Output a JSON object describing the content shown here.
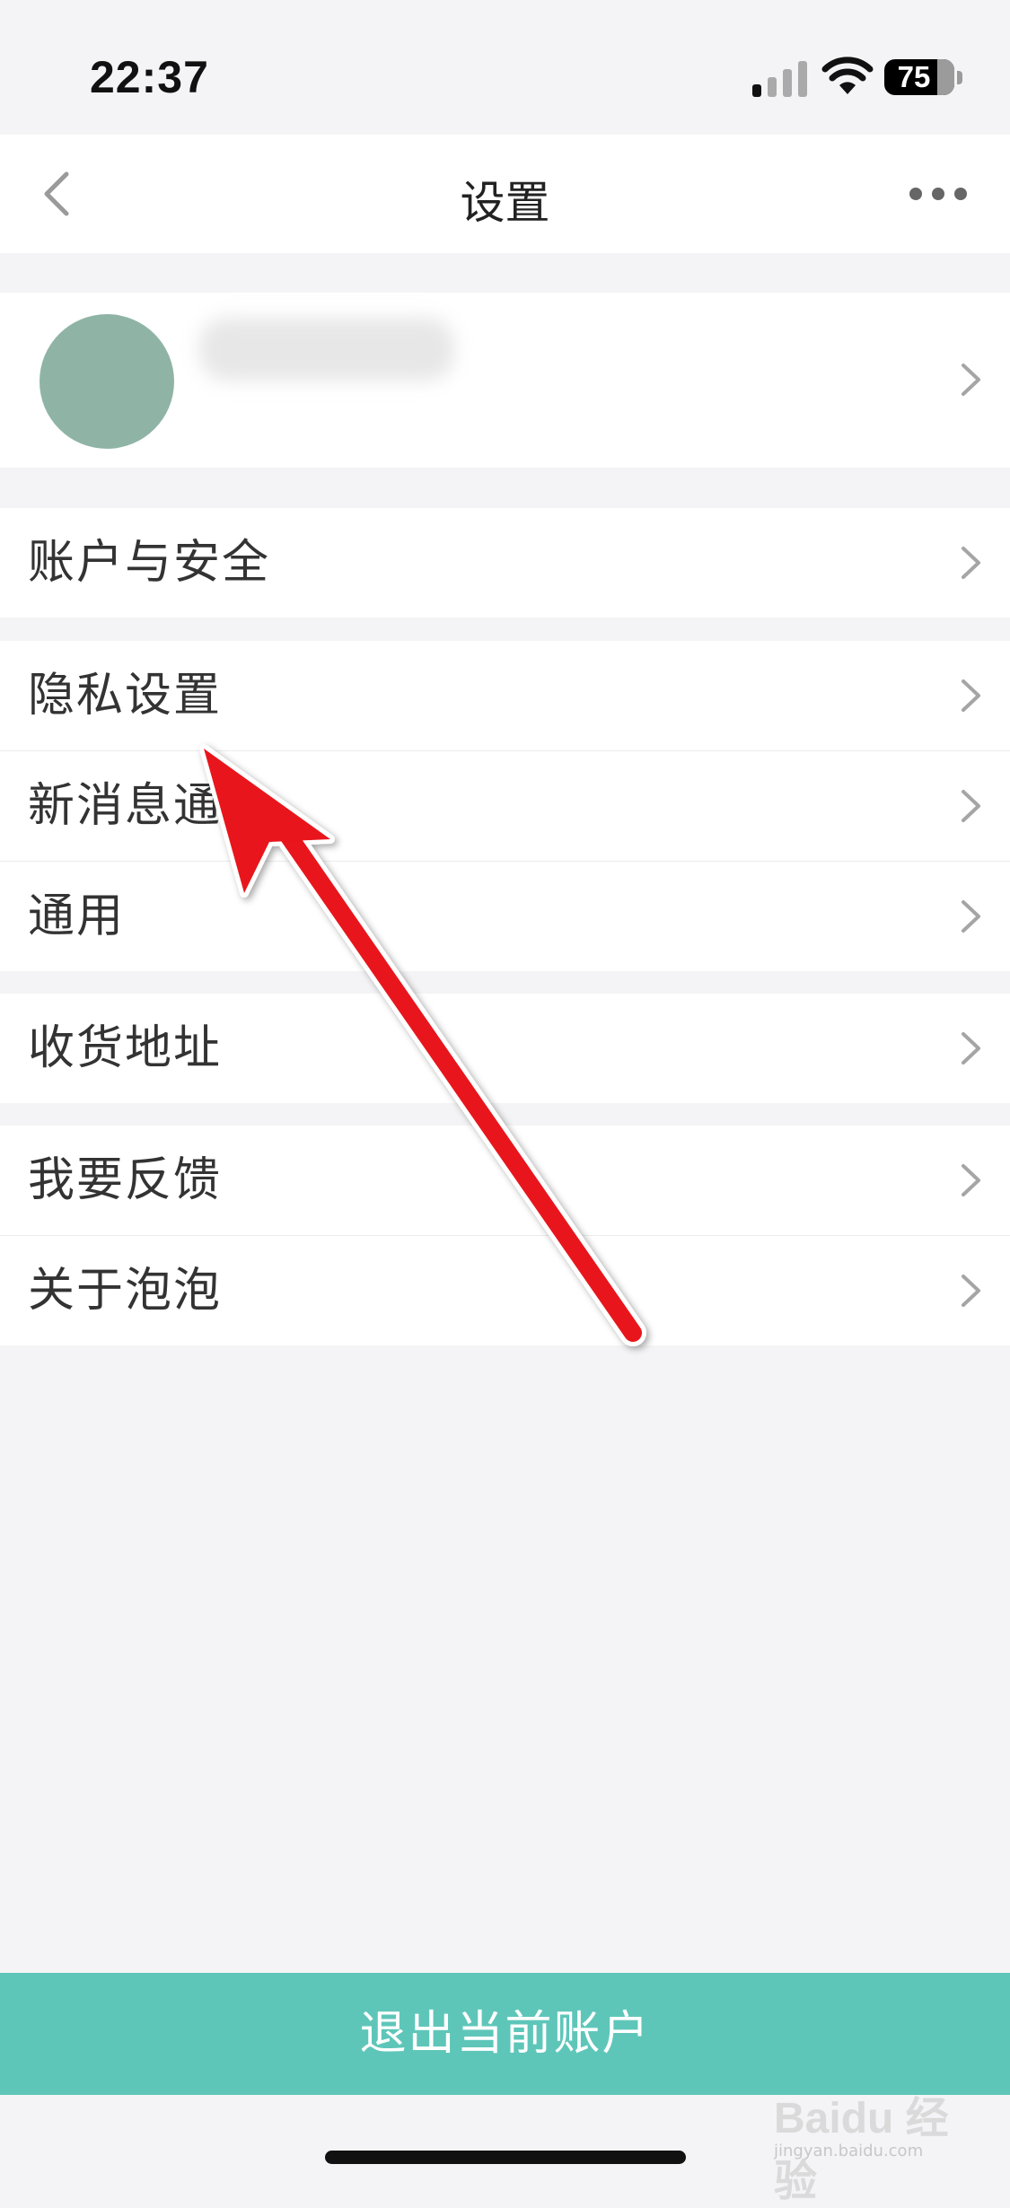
{
  "status_bar": {
    "time": "22:37",
    "battery": "75",
    "battery_level": 0.75
  },
  "nav": {
    "title": "设置"
  },
  "profile": {
    "username": ""
  },
  "groups": [
    [
      {
        "label": "账户与安全"
      }
    ],
    [
      {
        "label": "隐私设置"
      },
      {
        "label": "新消息通"
      },
      {
        "label": "通用"
      }
    ],
    [
      {
        "label": "收货地址"
      }
    ],
    [
      {
        "label": "我要反馈"
      },
      {
        "label": "关于泡泡"
      }
    ]
  ],
  "logout": {
    "label": "退出当前账户"
  },
  "watermark": {
    "brand": "Baidu 经验",
    "url": "jingyan.baidu.com"
  },
  "colors": {
    "accent": "#5ec6b9",
    "arrow": "#e8121a",
    "avatar": "#8fb4a6"
  },
  "icons": [
    "back-icon",
    "more-icon",
    "chevron-right-icon",
    "signal-icon",
    "wifi-icon",
    "battery-icon"
  ]
}
